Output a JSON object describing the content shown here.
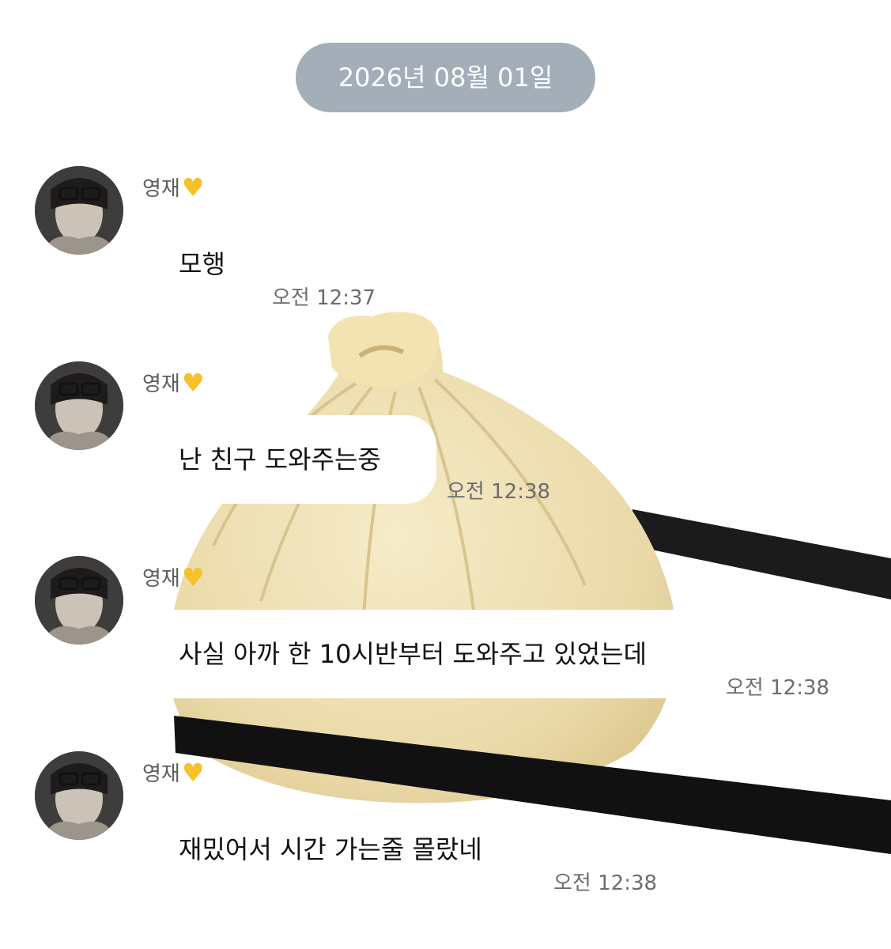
{
  "chat": {
    "date_label": "2026년 08월 01일",
    "messages": [
      {
        "sender": "영재",
        "heart_icon": "yellow-heart-icon",
        "text": "모행",
        "time": "오전 12:37"
      },
      {
        "sender": "영재",
        "heart_icon": "yellow-heart-icon",
        "text": "난 친구 도와주는중",
        "time": "오전 12:38"
      },
      {
        "sender": "영재",
        "heart_icon": "yellow-heart-icon",
        "text": "사실 아까 한 10시반부터 도와주고 있었는데",
        "time": "오전 12:38"
      },
      {
        "sender": "영재",
        "heart_icon": "yellow-heart-icon",
        "text": "재밌어서 시간 가는줄 몰랐네",
        "time": "오전 12:38"
      }
    ]
  },
  "colors": {
    "date_pill": "#a3aeb8",
    "heart": "#f7c12c",
    "bubble": "#ffffff",
    "timestamp": "#6c6c6c"
  }
}
